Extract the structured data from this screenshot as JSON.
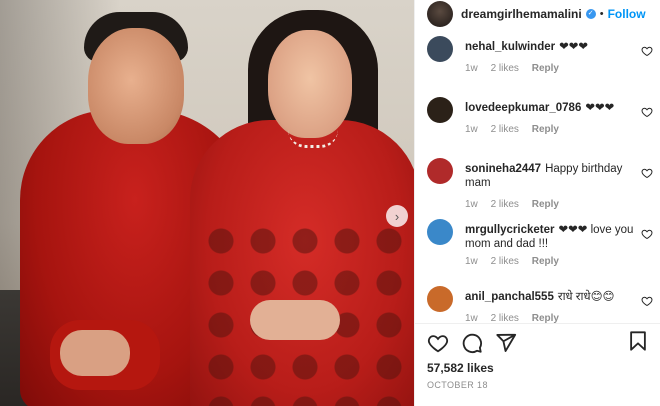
{
  "post": {
    "photo_alt": "",
    "next_icon": "chevron-right-icon",
    "next_glyph": "›"
  },
  "header": {
    "username": "dreamgirlhemamalini",
    "verified_icon": "verified-badge-icon",
    "verified_glyph": "✓",
    "separator": "•",
    "follow_label": "Follow"
  },
  "comments": [
    {
      "user": "nehal_kulwinder",
      "text": "❤❤❤",
      "age": "1w",
      "likes": "2 likes",
      "reply": "Reply",
      "avatar_color": "#3b4a5c"
    },
    {
      "user": "lovedeepkumar_0786",
      "text": "❤❤❤",
      "age": "1w",
      "likes": "2 likes",
      "reply": "Reply",
      "avatar_color": "#2b2118"
    },
    {
      "user": "sonineha2447",
      "text": "Happy birthday mam",
      "age": "1w",
      "likes": "2 likes",
      "reply": "Reply",
      "avatar_color": "#b02a2a"
    },
    {
      "user": "mrgullycricketer",
      "text": "❤❤❤ love you mom and dad !!!",
      "age": "1w",
      "likes": "2 likes",
      "reply": "Reply",
      "avatar_color": "#3a88c9"
    },
    {
      "user": "anil_panchal555",
      "text": "राधे राधे😊😊",
      "age": "1w",
      "likes": "2 likes",
      "reply": "Reply",
      "avatar_color": "#c96a2a"
    }
  ],
  "actions": {
    "like_icon": "heart-icon",
    "comment_icon": "comment-icon",
    "share_icon": "share-icon",
    "save_icon": "bookmark-icon"
  },
  "likes_count": "57,582 likes",
  "date": "OCTOBER 18"
}
